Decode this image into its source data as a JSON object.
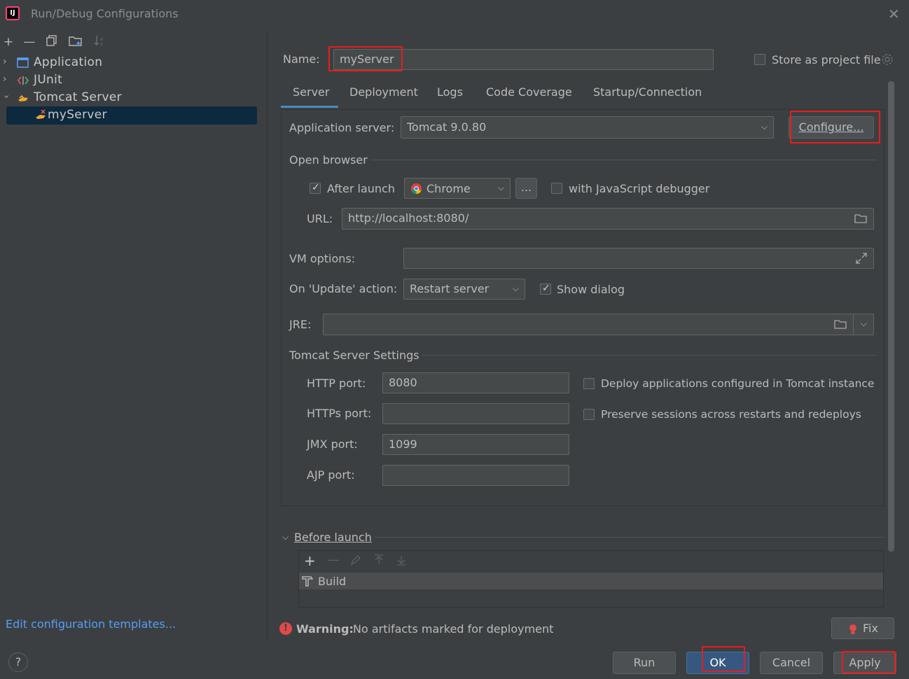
{
  "window": {
    "title": "Run/Debug Configurations",
    "close_label": "✕"
  },
  "sidebar": {
    "toolbar": [
      "add-icon",
      "remove-icon",
      "copy-icon",
      "folder-icon",
      "sort-icon"
    ],
    "items": [
      {
        "label": "Application",
        "icon": "application-icon"
      },
      {
        "label": "JUnit",
        "icon": "junit-icon"
      },
      {
        "label": "Tomcat Server",
        "icon": "tomcat-icon"
      },
      {
        "label": "myServer",
        "icon": "tomcat-error-icon"
      }
    ],
    "edit_templates": "Edit configuration templates...",
    "help_label": "?"
  },
  "header": {
    "name_label": "Name:",
    "name_value": "myServer",
    "store_label": "Store as project file"
  },
  "tabs": [
    "Server",
    "Deployment",
    "Logs",
    "Code Coverage",
    "Startup/Connection"
  ],
  "server": {
    "app_server_label": "Application server:",
    "app_server_value": "Tomcat 9.0.80",
    "configure_label": "Configure...",
    "open_browser_label": "Open browser",
    "after_launch_label": "After launch",
    "browser_value": "Chrome",
    "ellipsis_label": "...",
    "js_debugger_label": "with JavaScript debugger",
    "url_label": "URL:",
    "url_value": "http://localhost:8080/",
    "vm_options_label": "VM options:",
    "update_action_label": "On 'Update' action:",
    "update_action_value": "Restart server",
    "show_dialog_label": "Show dialog",
    "jre_label": "JRE:",
    "tomcat_settings_label": "Tomcat Server Settings",
    "http_port_label": "HTTP port:",
    "http_port_value": "8080",
    "https_port_label": "HTTPs port:",
    "https_port_value": "",
    "jmx_port_label": "JMX port:",
    "jmx_port_value": "1099",
    "ajp_port_label": "AJP port:",
    "ajp_port_value": "",
    "deploy_label": "Deploy applications configured in Tomcat instance",
    "preserve_label": "Preserve sessions across restarts and redeploys"
  },
  "before_launch": {
    "label": "Before launch",
    "items": [
      "Build"
    ]
  },
  "warning": {
    "bold": "Warning:",
    "text": "No artifacts marked for deployment",
    "fix_label": "Fix"
  },
  "footer": {
    "run_label": "Run",
    "ok_label": "OK",
    "cancel_label": "Cancel",
    "apply_label": "Apply"
  },
  "colors": {
    "accent": "#4a88c7",
    "highlight_box": "#e81d1d",
    "link": "#589df6",
    "error": "#e04a4a"
  }
}
